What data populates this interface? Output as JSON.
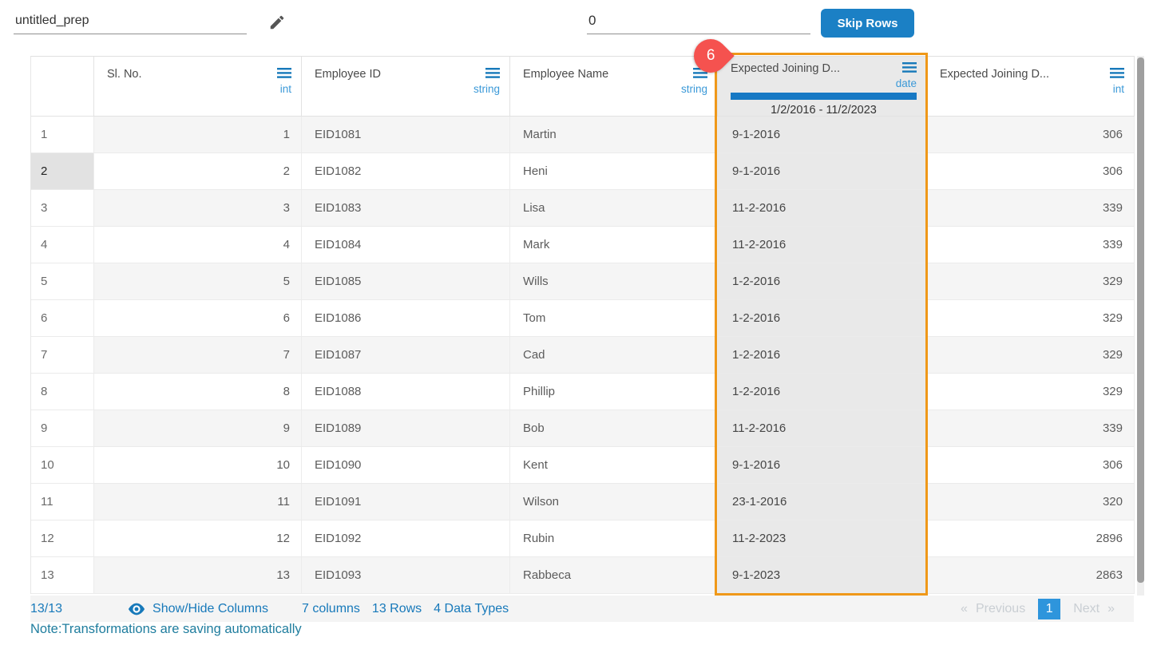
{
  "topbar": {
    "prep_name": "untitled_prep",
    "skip_value": "0",
    "skip_button": "Skip Rows"
  },
  "annotation": {
    "badge_label": "6"
  },
  "table": {
    "columns": [
      {
        "label": "",
        "type": ""
      },
      {
        "label": "Sl. No.",
        "type": "int"
      },
      {
        "label": "Employee ID",
        "type": "string"
      },
      {
        "label": "Employee Name",
        "type": "string"
      },
      {
        "label": "Expected Joining D...",
        "type": "date",
        "range": "1/2/2016 - 11/2/2023",
        "highlighted": true
      },
      {
        "label": "Expected Joining D...",
        "type": "int"
      }
    ],
    "rows": [
      {
        "num": "1",
        "sl": "1",
        "id": "EID1081",
        "name": "Martin",
        "date": "9-1-2016",
        "days": "306"
      },
      {
        "num": "2",
        "sl": "2",
        "id": "EID1082",
        "name": "Heni",
        "date": "9-1-2016",
        "days": "306"
      },
      {
        "num": "3",
        "sl": "3",
        "id": "EID1083",
        "name": "Lisa",
        "date": "11-2-2016",
        "days": "339"
      },
      {
        "num": "4",
        "sl": "4",
        "id": "EID1084",
        "name": "Mark",
        "date": "11-2-2016",
        "days": "339"
      },
      {
        "num": "5",
        "sl": "5",
        "id": "EID1085",
        "name": "Wills",
        "date": "1-2-2016",
        "days": "329"
      },
      {
        "num": "6",
        "sl": "6",
        "id": "EID1086",
        "name": "Tom",
        "date": "1-2-2016",
        "days": "329"
      },
      {
        "num": "7",
        "sl": "7",
        "id": "EID1087",
        "name": "Cad",
        "date": "1-2-2016",
        "days": "329"
      },
      {
        "num": "8",
        "sl": "8",
        "id": "EID1088",
        "name": "Phillip",
        "date": "1-2-2016",
        "days": "329"
      },
      {
        "num": "9",
        "sl": "9",
        "id": "EID1089",
        "name": "Bob",
        "date": "11-2-2016",
        "days": "339"
      },
      {
        "num": "10",
        "sl": "10",
        "id": "EID1090",
        "name": "Kent",
        "date": "9-1-2016",
        "days": "306"
      },
      {
        "num": "11",
        "sl": "11",
        "id": "EID1091",
        "name": "Wilson",
        "date": "23-1-2016",
        "days": "320"
      },
      {
        "num": "12",
        "sl": "12",
        "id": "EID1092",
        "name": "Rubin",
        "date": "11-2-2023",
        "days": "2896"
      },
      {
        "num": "13",
        "sl": "13",
        "id": "EID1093",
        "name": "Rabbeca",
        "date": "9-1-2023",
        "days": "2863"
      }
    ]
  },
  "footer": {
    "count": "13/13",
    "show_hide": "Show/Hide Columns",
    "columns_info": "7 columns",
    "rows_info": "13 Rows",
    "types_info": "4 Data Types",
    "prev_arrow": "«",
    "prev": "Previous",
    "page": "1",
    "next": "Next",
    "next_arrow": "»"
  },
  "note": "Note:Transformations are saving automatically",
  "icons": {
    "pencil-icon": "edit",
    "menu-icon": "column-menu-hamburger",
    "eye-icon": "show-hide-visibility"
  },
  "colors": {
    "accent_blue": "#1779ba",
    "button_blue": "#1b80c5",
    "active_page_blue": "#2e95dc",
    "highlight_orange": "#ef9819",
    "badge_red": "#f5524f",
    "note_teal": "#1f7d9e"
  }
}
